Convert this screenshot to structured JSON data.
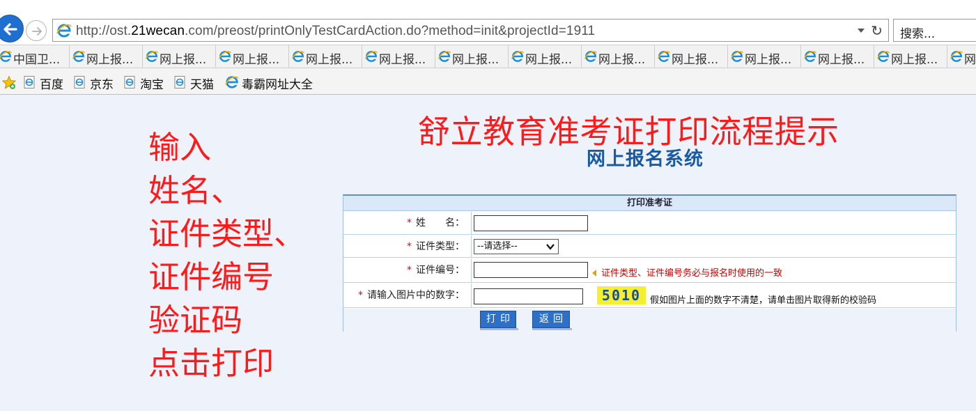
{
  "browser": {
    "url_prefix": "http://ost.",
    "url_domain": "21wecan",
    "url_rest": ".com/preost/printOnlyTestCardAction.do?method=init&projectId=1911",
    "search_placeholder": "搜索...",
    "tabs": [
      {
        "label": "中国卫..."
      },
      {
        "label": "网上报..."
      },
      {
        "label": "网上报..."
      },
      {
        "label": "网上报..."
      },
      {
        "label": "网上报..."
      },
      {
        "label": "网上报..."
      },
      {
        "label": "网上报..."
      },
      {
        "label": "网上报..."
      },
      {
        "label": "网上报..."
      },
      {
        "label": "网上报..."
      },
      {
        "label": "网上报..."
      },
      {
        "label": "网上报..."
      },
      {
        "label": "网上报..."
      },
      {
        "label": "网上报..."
      }
    ],
    "favorites": [
      {
        "label": "百度"
      },
      {
        "label": "京东"
      },
      {
        "label": "淘宝"
      },
      {
        "label": "天猫"
      },
      {
        "label": "毒霸网址大全"
      }
    ]
  },
  "annotation": {
    "title": "舒立教育准考证打印流程提示",
    "steps": [
      "输入",
      "姓名、",
      "证件类型、",
      "证件编号",
      "验证码",
      "点击打印"
    ]
  },
  "page": {
    "system_name": "网上报名系统"
  },
  "form": {
    "heading": "打印准考证",
    "required_mark": "*",
    "name_label": "姓　　名：",
    "name_value": "",
    "id_type_label": "证件类型：",
    "id_type_selected": "--请选择--",
    "id_number_label": "证件编号：",
    "id_number_value": "",
    "id_tip": "证件类型、证件编号务必与报名时使用的一致",
    "captcha_label": "请输入图片中的数字：",
    "captcha_value": "",
    "captcha_image_text": "5010",
    "captcha_tip": "假如图片上面的数字不清楚，请单击图片取得新的校验码",
    "print_button": "打印",
    "back_button": "返回"
  },
  "colors": {
    "annotation_red": "#ff1a1a",
    "system_title_blue": "#1a5aa3",
    "button_blue": "#2e70c8",
    "captcha_yellow": "#f5f02f"
  }
}
